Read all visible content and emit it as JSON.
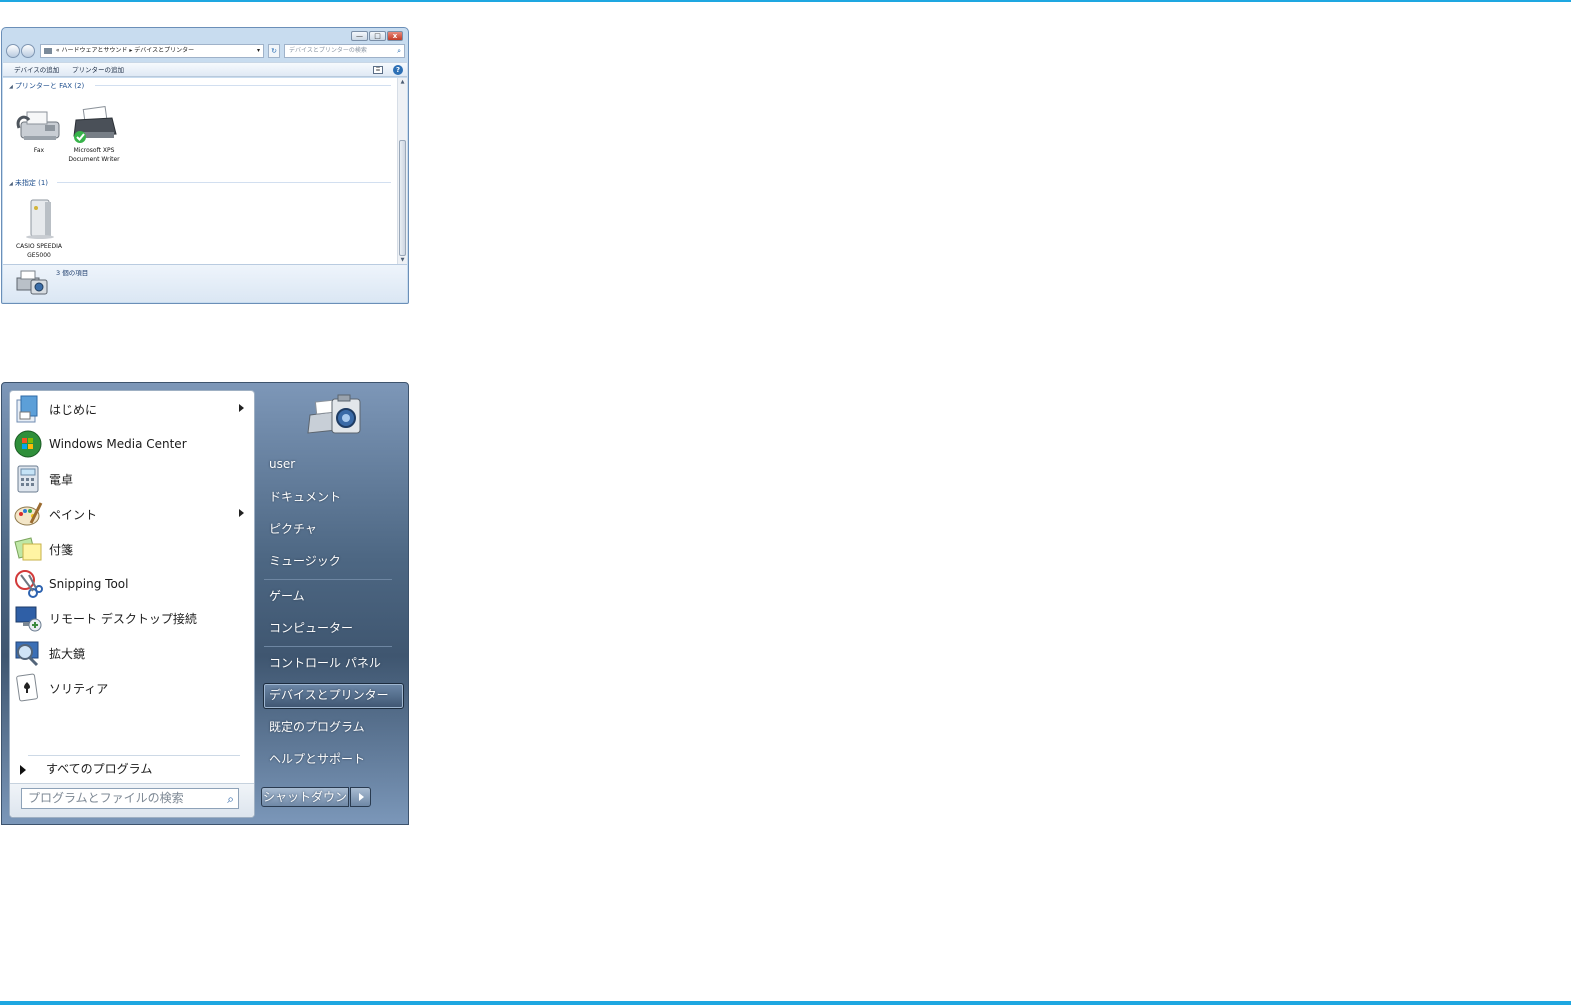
{
  "explorer": {
    "window_buttons": [
      "—",
      "□",
      "x"
    ],
    "breadcrumb": {
      "prefix": "«",
      "segments": [
        "ハードウェアとサウンド",
        "デバイスとプリンター"
      ],
      "separator": "▸"
    },
    "search_placeholder": "デバイスとプリンターの検索",
    "commands": [
      "デバイスの追加",
      "プリンターの追加"
    ],
    "help_glyph": "?",
    "groups": [
      {
        "label": "プリンターと FAX (2)",
        "devices": [
          {
            "name": "Fax",
            "icon": "fax-icon"
          },
          {
            "name": "Microsoft XPS Document Writer",
            "icon": "printer-icon",
            "default": true
          }
        ]
      },
      {
        "label": "未指定 (1)",
        "devices": [
          {
            "name": "CASIO SPEEDIA GE5000",
            "icon": "tower-device-icon"
          }
        ]
      }
    ],
    "status": "3 個の項目"
  },
  "start_menu": {
    "programs": [
      {
        "label": "はじめに",
        "icon": "getting-started-icon",
        "submenu": true
      },
      {
        "label": "Windows Media Center",
        "icon": "media-center-icon",
        "submenu": false
      },
      {
        "label": "電卓",
        "icon": "calculator-icon",
        "submenu": false
      },
      {
        "label": "ペイント",
        "icon": "paint-icon",
        "submenu": true
      },
      {
        "label": "付箋",
        "icon": "sticky-notes-icon",
        "submenu": false
      },
      {
        "label": "Snipping Tool",
        "icon": "snipping-tool-icon",
        "submenu": false
      },
      {
        "label": "リモート デスクトップ接続",
        "icon": "remote-desktop-icon",
        "submenu": false
      },
      {
        "label": "拡大鏡",
        "icon": "magnifier-icon",
        "submenu": false
      },
      {
        "label": "ソリティア",
        "icon": "solitaire-icon",
        "submenu": false
      }
    ],
    "all_programs": "すべてのプログラム",
    "search_placeholder": "プログラムとファイルの検索",
    "right_links": [
      "user",
      "ドキュメント",
      "ピクチャ",
      "ミュージック",
      "ゲーム",
      "コンピューター",
      "コントロール パネル",
      "デバイスとプリンター",
      "既定のプログラム",
      "ヘルプとサポート"
    ],
    "selected_link": "デバイスとプリンター",
    "shutdown": "シャットダウン"
  },
  "colors": {
    "accent_line": "#1ea7e1",
    "group_header": "#1f4f8e"
  }
}
